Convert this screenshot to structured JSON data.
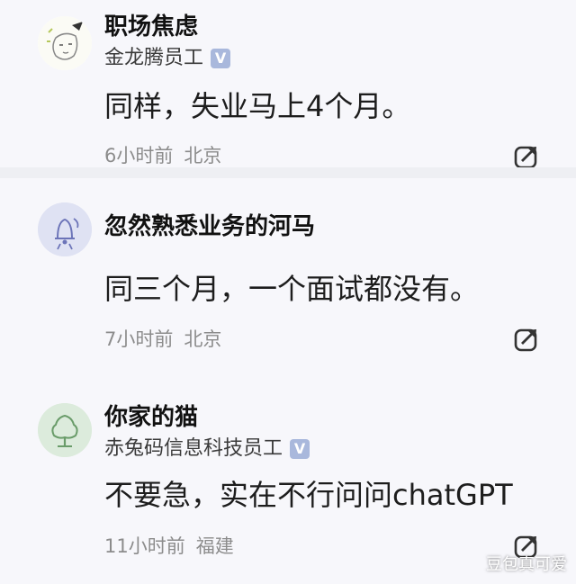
{
  "comments": [
    {
      "username": "职场焦虑",
      "organization": "金龙腾员工",
      "verified": true,
      "text": "同样，失业马上4个月。",
      "time": "6小时前",
      "location": "北京"
    },
    {
      "username": "忽然熟悉业务的河马",
      "organization": "",
      "verified": false,
      "text": "同三个月，一个面试都没有。",
      "time": "7小时前",
      "location": "北京"
    },
    {
      "username": "你家的猫",
      "organization": "赤兔码信息科技员工",
      "verified": true,
      "text": "不要急，实在不行问问chatGPT",
      "time": "11小时前",
      "location": "福建"
    }
  ],
  "verified_badge": "V",
  "watermark": "豆包真可爱",
  "icons": {
    "avatar_1": "sketch-avatar-icon",
    "avatar_2": "bell-avatar-icon",
    "avatar_3": "tree-avatar-icon",
    "share": "share-arrow-icon"
  },
  "colors": {
    "background": "#f7f7fb",
    "divider": "#eeeff3",
    "verified_badge": "#a9b8dc",
    "meta_text": "#8c8c8c"
  }
}
